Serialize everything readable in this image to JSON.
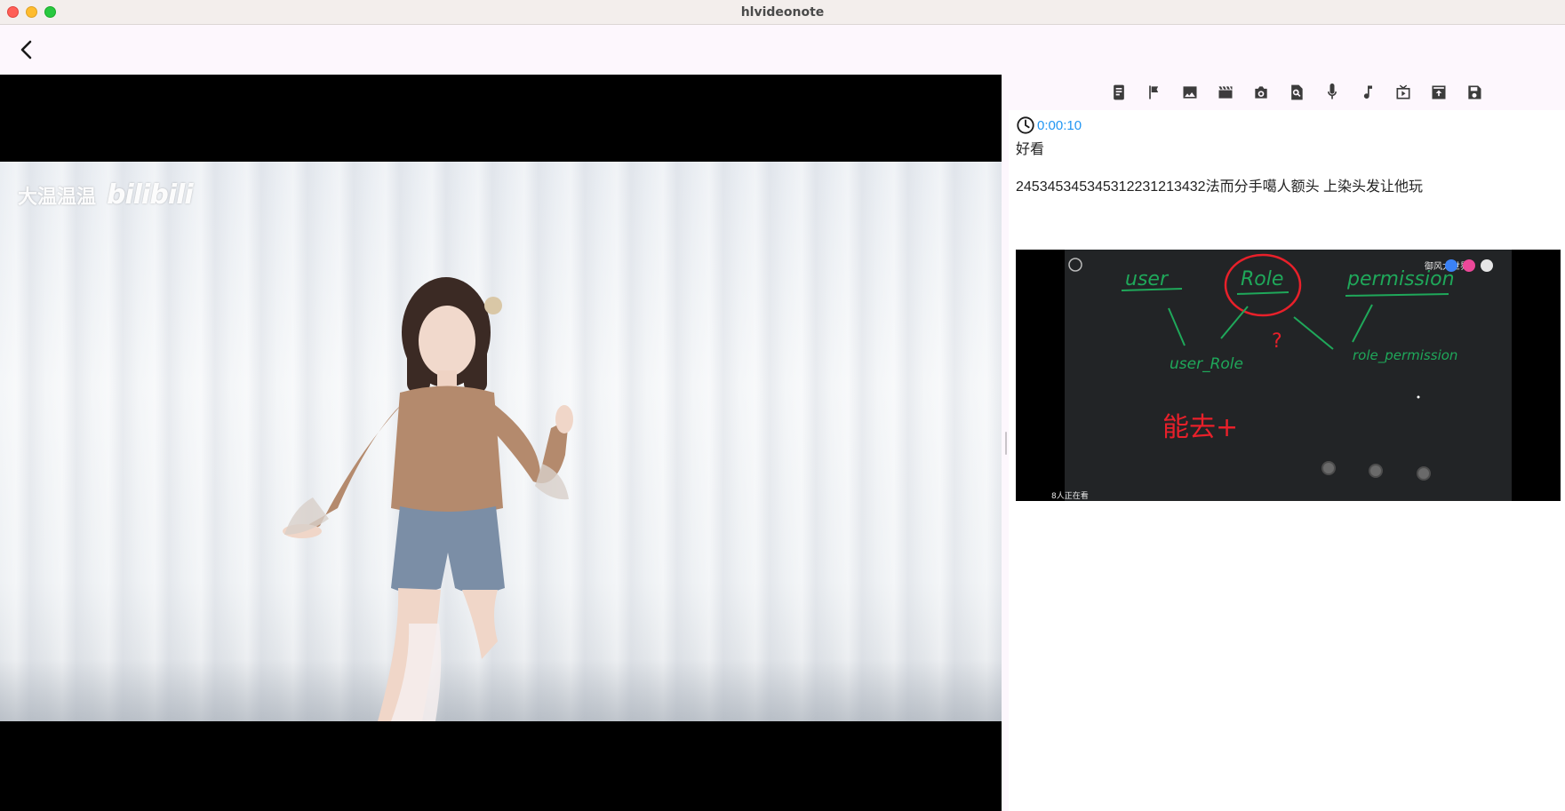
{
  "window": {
    "title": "hlvideonote"
  },
  "video": {
    "watermark_name": "大温温温",
    "watermark_brand": "bilibili"
  },
  "toolbar": {
    "tools": [
      {
        "icon": "phone-note-icon"
      },
      {
        "icon": "flag-icon"
      },
      {
        "icon": "image-icon"
      },
      {
        "icon": "clapperboard-icon"
      },
      {
        "icon": "camera-icon"
      },
      {
        "icon": "search-document-icon"
      },
      {
        "icon": "microphone-icon"
      },
      {
        "icon": "music-note-icon"
      },
      {
        "icon": "video-play-icon"
      },
      {
        "icon": "upload-box-icon"
      },
      {
        "icon": "save-icon"
      }
    ]
  },
  "note": {
    "timestamp": "0:00:10",
    "title": "好看",
    "body": "2453453453453122312134​32法而分手噶人额头 上染头发让他玩"
  },
  "screenshot": {
    "words": {
      "user": "user",
      "role": "Role",
      "permission": "permission",
      "user_role": "user_Role",
      "role_permission": "role_permission",
      "question": "?",
      "handwriting": "能去+"
    },
    "overlay_text": "御风大世界",
    "footer_text": "8人正在看"
  },
  "colors": {
    "accent_link": "#2196f3",
    "board_green": "#1fa85a",
    "board_red": "#e8202a",
    "panel_bg": "#fdf7fd"
  }
}
